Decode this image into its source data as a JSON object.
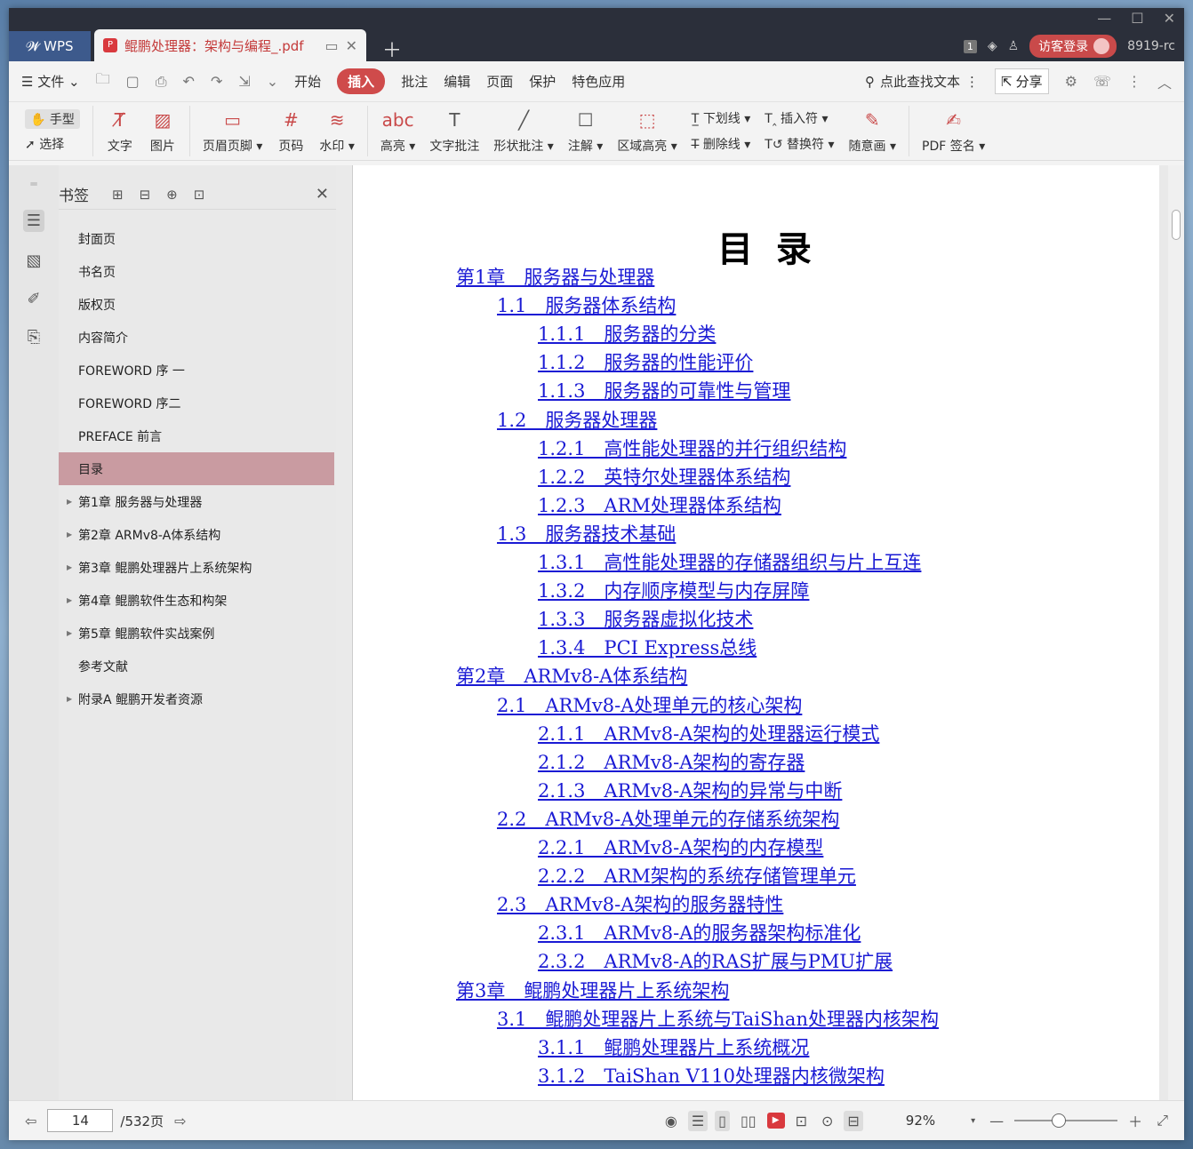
{
  "titlebar": {
    "app_tab": "WPS",
    "doc_tab_title": "鲲鹏处理器：架构与编程_.pdf",
    "badge": "1",
    "guest_label": "访客登录",
    "user_label": "8919-rc"
  },
  "menubar": {
    "file": "文件",
    "tabs": [
      "开始",
      "插入",
      "批注",
      "编辑",
      "页面",
      "保护",
      "特色应用"
    ],
    "active_tab": "插入",
    "search_label": "点此查找文本",
    "share_label": "分享"
  },
  "ribbon": {
    "hand": "手型",
    "select": "选择",
    "text": "文字",
    "image": "图片",
    "header_footer": "页眉页脚",
    "page_number": "页码",
    "watermark": "水印",
    "highlight": "高亮",
    "text_comment": "文字批注",
    "shape_comment": "形状批注",
    "annotation": "注解",
    "area_highlight": "区域高亮",
    "underline": "下划线",
    "strikethrough": "删除线",
    "insert_mark": "插入符",
    "replace_mark": "替换符",
    "freehand": "随意画",
    "pdf_sign": "PDF 签名"
  },
  "bookmarks": {
    "title": "书签",
    "items": [
      {
        "label": "封面页",
        "expandable": false
      },
      {
        "label": "书名页",
        "expandable": false
      },
      {
        "label": "版权页",
        "expandable": false
      },
      {
        "label": "内容简介",
        "expandable": false
      },
      {
        "label": "FOREWORD 序 一",
        "expandable": false
      },
      {
        "label": "FOREWORD 序二",
        "expandable": false
      },
      {
        "label": "PREFACE 前言",
        "expandable": false
      },
      {
        "label": "目录",
        "expandable": false,
        "selected": true
      },
      {
        "label": "第1章 服务器与处理器",
        "expandable": true
      },
      {
        "label": "第2章 ARMv8-A体系结构",
        "expandable": true
      },
      {
        "label": "第3章 鲲鹏处理器片上系统架构",
        "expandable": true
      },
      {
        "label": "第4章 鲲鹏软件生态和构架",
        "expandable": true
      },
      {
        "label": "第5章 鲲鹏软件实战案例",
        "expandable": true
      },
      {
        "label": "参考文献",
        "expandable": false
      },
      {
        "label": "附录A 鲲鹏开发者资源",
        "expandable": true
      }
    ]
  },
  "document": {
    "heading": "目 录",
    "toc": [
      {
        "level": 1,
        "text": "第1章　服务器与处理器"
      },
      {
        "level": 2,
        "text": "1.1　服务器体系结构"
      },
      {
        "level": 3,
        "text": "1.1.1　服务器的分类"
      },
      {
        "level": 3,
        "text": "1.1.2　服务器的性能评价"
      },
      {
        "level": 3,
        "text": "1.1.3　服务器的可靠性与管理"
      },
      {
        "level": 2,
        "text": "1.2　服务器处理器"
      },
      {
        "level": 3,
        "text": "1.2.1　高性能处理器的并行组织结构"
      },
      {
        "level": 3,
        "text": "1.2.2　英特尔处理器体系结构"
      },
      {
        "level": 3,
        "text": "1.2.3　ARM处理器体系结构"
      },
      {
        "level": 2,
        "text": "1.3　服务器技术基础"
      },
      {
        "level": 3,
        "text": "1.3.1　高性能处理器的存储器组织与片上互连"
      },
      {
        "level": 3,
        "text": "1.3.2　内存顺序模型与内存屏障"
      },
      {
        "level": 3,
        "text": "1.3.3　服务器虚拟化技术"
      },
      {
        "level": 3,
        "text": "1.3.4　PCI Express总线"
      },
      {
        "level": 1,
        "text": "第2章　ARMv8-A体系结构"
      },
      {
        "level": 2,
        "text": "2.1　ARMv8-A处理单元的核心架构"
      },
      {
        "level": 3,
        "text": "2.1.1　ARMv8-A架构的处理器运行模式"
      },
      {
        "level": 3,
        "text": "2.1.2　ARMv8-A架构的寄存器"
      },
      {
        "level": 3,
        "text": "2.1.3　ARMv8-A架构的异常与中断"
      },
      {
        "level": 2,
        "text": "2.2　ARMv8-A处理单元的存储系统架构"
      },
      {
        "level": 3,
        "text": "2.2.1　ARMv8-A架构的内存模型"
      },
      {
        "level": 3,
        "text": "2.2.2　ARM架构的系统存储管理单元"
      },
      {
        "level": 2,
        "text": "2.3　ARMv8-A架构的服务器特性"
      },
      {
        "level": 3,
        "text": "2.3.1　ARMv8-A的服务器架构标准化"
      },
      {
        "level": 3,
        "text": "2.3.2　ARMv8-A的RAS扩展与PMU扩展"
      },
      {
        "level": 1,
        "text": "第3章　鲲鹏处理器片上系统架构"
      },
      {
        "level": 2,
        "text": "3.1　鲲鹏处理器片上系统与TaiShan处理器内核架构"
      },
      {
        "level": 3,
        "text": "3.1.1　鲲鹏处理器片上系统概况"
      },
      {
        "level": 3,
        "text": "3.1.2　TaiShan V110处理器内核微架构"
      }
    ]
  },
  "statusbar": {
    "current_page": "14",
    "total_pages": "/532页",
    "zoom": "92%"
  },
  "colors": {
    "accent": "#cf4b4b",
    "link": "#1a1ad4",
    "selected_bookmark": "#c99ba1"
  }
}
